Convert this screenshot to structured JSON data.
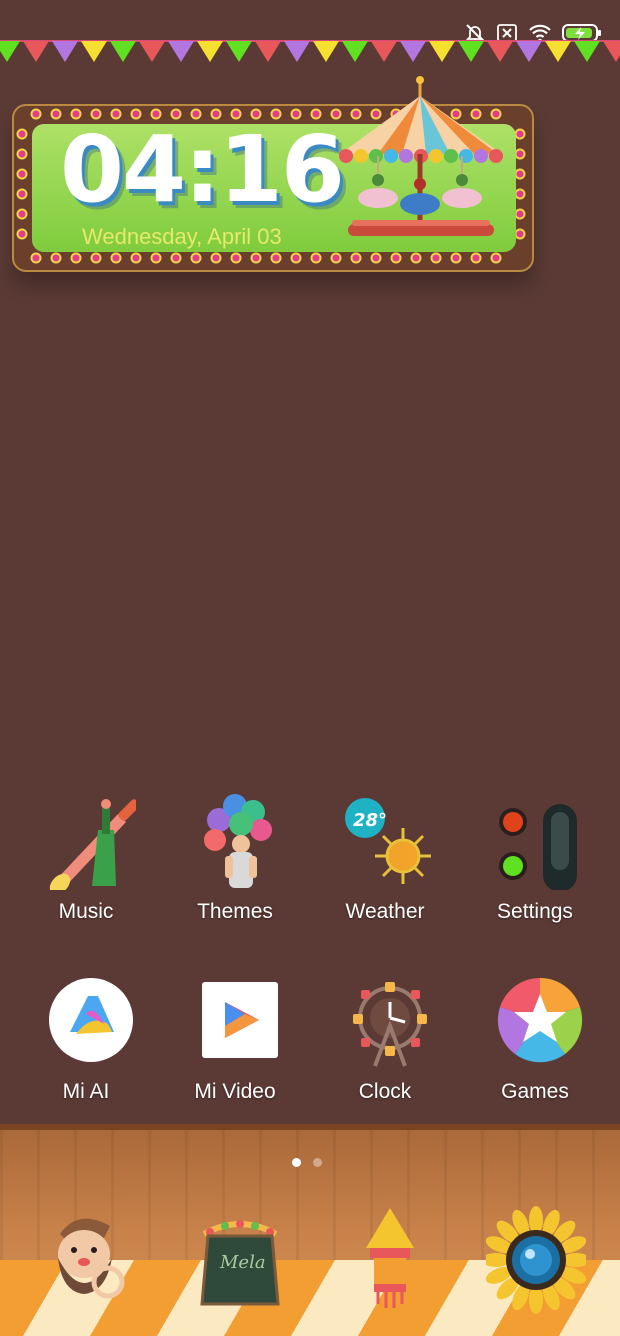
{
  "status_bar": {
    "icons": [
      "muted-bell-icon",
      "no-sim-icon",
      "wifi-icon",
      "battery-charging-icon"
    ]
  },
  "clock_widget": {
    "time": "04:16",
    "date": "Wednesday, April 03"
  },
  "apps": [
    {
      "label": "Music",
      "icon": "vuvuzela-icon"
    },
    {
      "label": "Themes",
      "icon": "balloon-seller-icon"
    },
    {
      "label": "Weather",
      "icon": "sun-icon",
      "badge": "28°"
    },
    {
      "label": "Settings",
      "icon": "traffic-light-toggle-icon"
    },
    {
      "label": "Mi AI",
      "icon": "mi-ai-icon"
    },
    {
      "label": "Mi Video",
      "icon": "play-icon"
    },
    {
      "label": "Clock",
      "icon": "ferris-wheel-icon"
    },
    {
      "label": "Games",
      "icon": "star-icon"
    }
  ],
  "page_indicator": {
    "pages": 2,
    "current": 1
  },
  "dock": {
    "items": [
      {
        "icon": "bearded-man-phone-icon"
      },
      {
        "icon": "mela-board-icon",
        "text": "Mela"
      },
      {
        "icon": "lantern-icon"
      },
      {
        "icon": "sunflower-camera-icon"
      }
    ]
  },
  "colors": {
    "wallpaper": "#5b3a35",
    "widget_green": "#8fd44a",
    "date_yellow": "#e8e86a"
  }
}
